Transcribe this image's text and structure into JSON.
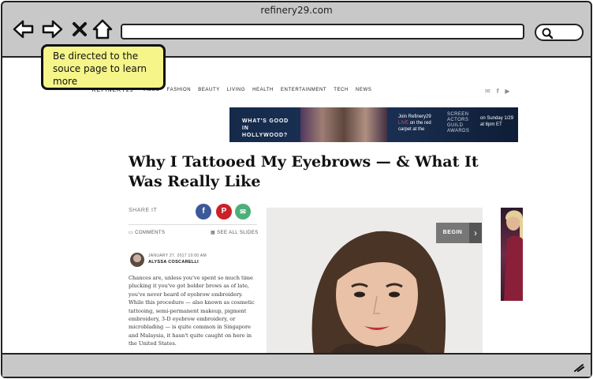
{
  "browser": {
    "tab_title": "refinery29.com"
  },
  "site": {
    "logo_mark": "29",
    "logo_text": "REFINERY29",
    "nav": [
      "VIDEO",
      "FASHION",
      "BEAUTY",
      "LIVING",
      "HEALTH",
      "ENTERTAINMENT",
      "TECH",
      "NEWS"
    ],
    "social_icons": [
      "mail-icon",
      "facebook-icon",
      "youtube-icon"
    ]
  },
  "callout": {
    "text": "Be directed to the souce page to learn more",
    "color": "#f5f58a"
  },
  "ad_banner": {
    "headline": "WHAT'S GOOD IN HOLLYWOOD?",
    "join_line1": "Join Refinery29",
    "join_live": "LIVE",
    "join_line2": "on the red carpet at the",
    "award_name": "SCREEN ACTORS GUILD AWARDS",
    "date_line": "on Sunday 1/29 at 6pm ET"
  },
  "article": {
    "headline": "Why I Tattooed My Eyebrows — & What It Was Really Like",
    "share_label": "SHARE IT",
    "comments_label": "COMMENTS",
    "slides_label": "SEE ALL SLIDES",
    "date": "JANUARY 27, 2017 10:00 AM",
    "author": "ALYSSA COSCARELLI",
    "body": "Chances are, unless you've spent so much time plucking it you've got bolder brows as of late, you've never heard of eyebrow embroidery. While this procedure — also known as cosmetic tattooing, semi-permanent makeup, pigment embroidery, 3-D eyebrow embroidery, or microblading — is quite common in Singapore and Malaysia, it hasn't quite caught on here in the United States.",
    "begin_label": "BEGIN",
    "colors": {
      "facebook": "#3b5998",
      "pinterest": "#cb2027",
      "email": "#4caf7a"
    }
  }
}
